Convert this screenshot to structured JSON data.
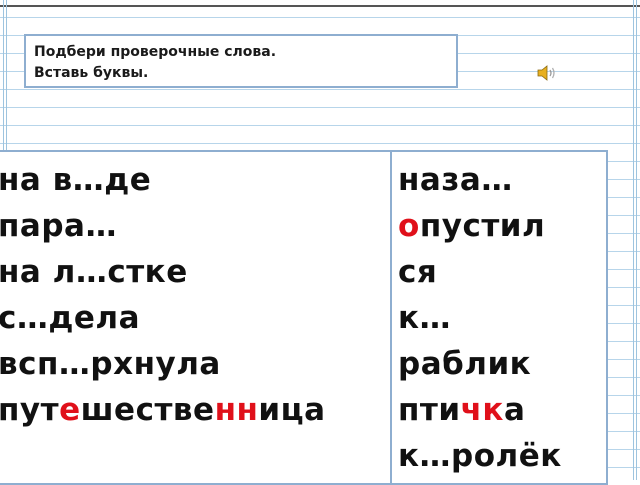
{
  "instruction": {
    "line1": "Подбери проверочные слова.",
    "line2": "Вставь буквы."
  },
  "icons": {
    "sound": "speaker-sound-icon"
  },
  "colors": {
    "highlight": "#e0101a",
    "border": "#8eaed0",
    "ruling": "#b7d5ea"
  },
  "left_words": {
    "w1": "на в…де",
    "w2": "пара…",
    "w3": "на л…стке",
    "w4": "с…дела",
    "w5": "всп…рхнула",
    "w6": {
      "a": "пут",
      "b": "е",
      "c": "шестве",
      "d": "нн",
      "e": "ица"
    }
  },
  "right_words": {
    "w1": "наза…",
    "w2": {
      "a": "о",
      "b": "пустил"
    },
    "w3": "ся",
    "w4": "к…",
    "w5": "раблик",
    "w6": {
      "a": "пти",
      "b": "чк",
      "c": "а"
    },
    "w7": "к…ролёк"
  }
}
